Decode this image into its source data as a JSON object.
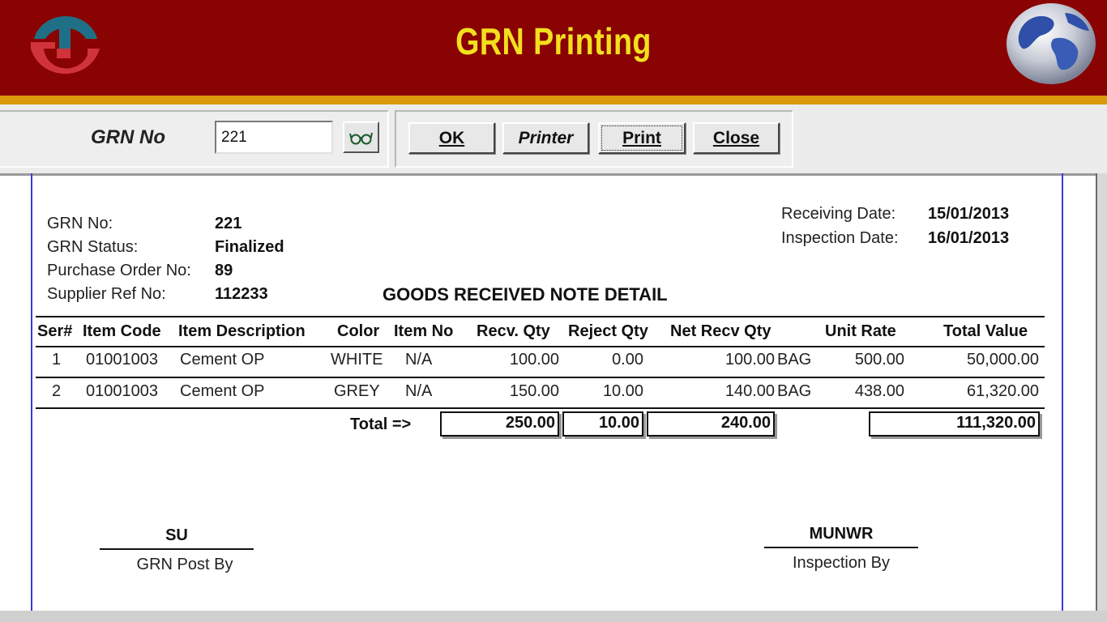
{
  "header": {
    "title": "GRN Printing"
  },
  "toolbar": {
    "grn_label": "GRN No",
    "grn_value": "221",
    "buttons": {
      "ok": "OK",
      "printer": "Printer",
      "print": "Print",
      "close": "Close"
    }
  },
  "report": {
    "info_left": [
      {
        "label": "GRN No:",
        "value": "221"
      },
      {
        "label": "GRN Status:",
        "value": "Finalized"
      },
      {
        "label": "Purchase Order No:",
        "value": "89"
      },
      {
        "label": "Supplier Ref No:",
        "value": "112233"
      }
    ],
    "info_right": [
      {
        "label": "Receiving Date:",
        "value": "15/01/2013"
      },
      {
        "label": "Inspection Date:",
        "value": "16/01/2013"
      }
    ],
    "heading": "GOODS RECEIVED NOTE DETAIL",
    "columns": [
      "Ser#",
      "Item Code",
      "Item Description",
      "Color",
      "Item No",
      "Recv. Qty",
      "Reject Qty",
      "Net Recv Qty",
      "Unit Rate",
      "Total Value"
    ],
    "rows": [
      {
        "ser": "1",
        "code": "01001003",
        "desc": "Cement OP",
        "color": "WHITE",
        "item_no": "N/A",
        "recv": "100.00",
        "reject": "0.00",
        "net": "100.00",
        "unit": "BAG",
        "rate": "500.00",
        "total": "50,000.00"
      },
      {
        "ser": "2",
        "code": "01001003",
        "desc": "Cement OP",
        "color": "GREY",
        "item_no": "N/A",
        "recv": "150.00",
        "reject": "10.00",
        "net": "140.00",
        "unit": "BAG",
        "rate": "438.00",
        "total": "61,320.00"
      }
    ],
    "totals": {
      "label": "Total =>",
      "recv": "250.00",
      "reject": "10.00",
      "net": "240.00",
      "value": "111,320.00"
    },
    "signatures": [
      {
        "name": "SU",
        "role": "GRN Post By"
      },
      {
        "name": "MUNWR",
        "role": "Inspection By"
      }
    ]
  },
  "colors": {
    "header_bg": "#8a0303",
    "title": "#f2df1d",
    "band": "#d89a0c",
    "logo_blue": "#1f6f86",
    "logo_red": "#d0343a"
  },
  "icons": {
    "logo": "company-logo",
    "globe": "globe-icon",
    "lookup": "glasses-icon"
  }
}
